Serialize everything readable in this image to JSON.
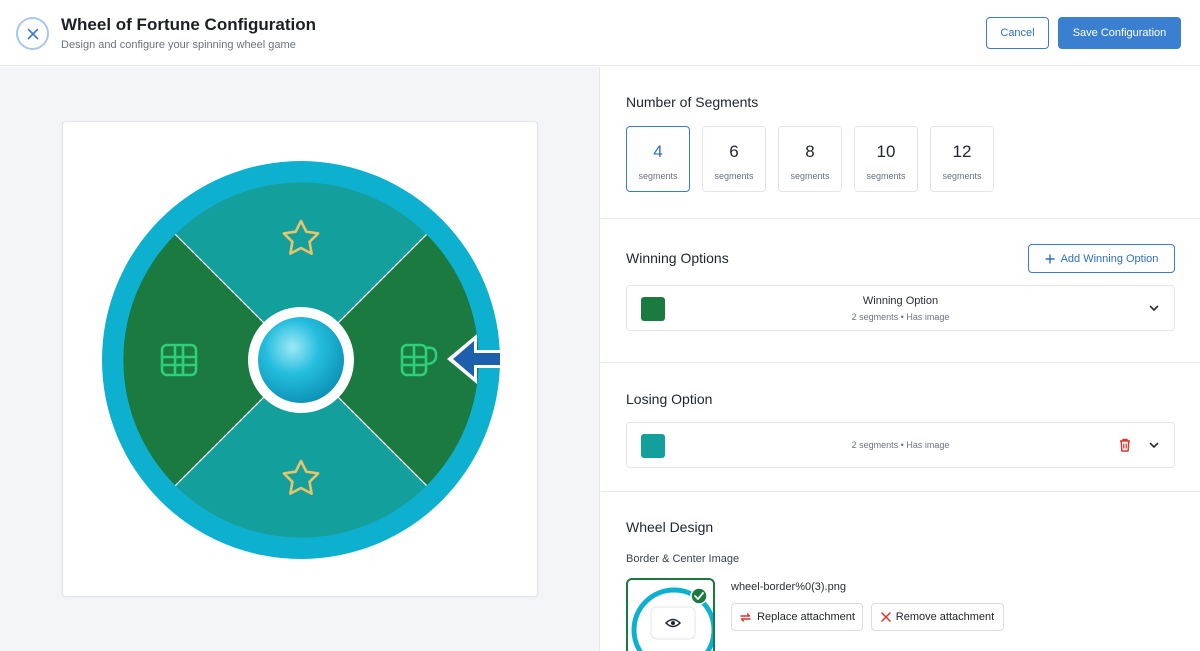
{
  "header": {
    "title": "Wheel of Fortune Configuration",
    "subtitle": "Design and configure your spinning wheel game",
    "cancel_label": "Cancel",
    "save_label": "Save Configuration"
  },
  "segments": {
    "title": "Number of Segments",
    "options": [
      {
        "value": "4",
        "label": "segments",
        "selected": true
      },
      {
        "value": "6",
        "label": "segments",
        "selected": false
      },
      {
        "value": "8",
        "label": "segments",
        "selected": false
      },
      {
        "value": "10",
        "label": "segments",
        "selected": false
      },
      {
        "value": "12",
        "label": "segments",
        "selected": false
      }
    ]
  },
  "winning": {
    "title": "Winning Options",
    "add_label": "Add Winning Option",
    "items": [
      {
        "name": "Winning Option",
        "meta": "2 segments • Has image",
        "color": "#1a7a3f"
      }
    ]
  },
  "losing": {
    "title": "Losing Option",
    "meta": "2 segments • Has image",
    "color": "#13a09c"
  },
  "design": {
    "title": "Wheel Design",
    "sub_label": "Border & Center Image",
    "file_name": "wheel-border%0(3).png",
    "replace_label": "Replace attachment",
    "remove_label": "Remove attachment"
  },
  "colors": {
    "accent": "#3b7fd0",
    "border_ring": "#0eb0d0",
    "win_segment": "#1a7a3f",
    "lose_segment": "#13a09c",
    "icon_gold": "#e8c36a",
    "icon_green": "#2ecf7a",
    "danger": "#d9342b"
  }
}
